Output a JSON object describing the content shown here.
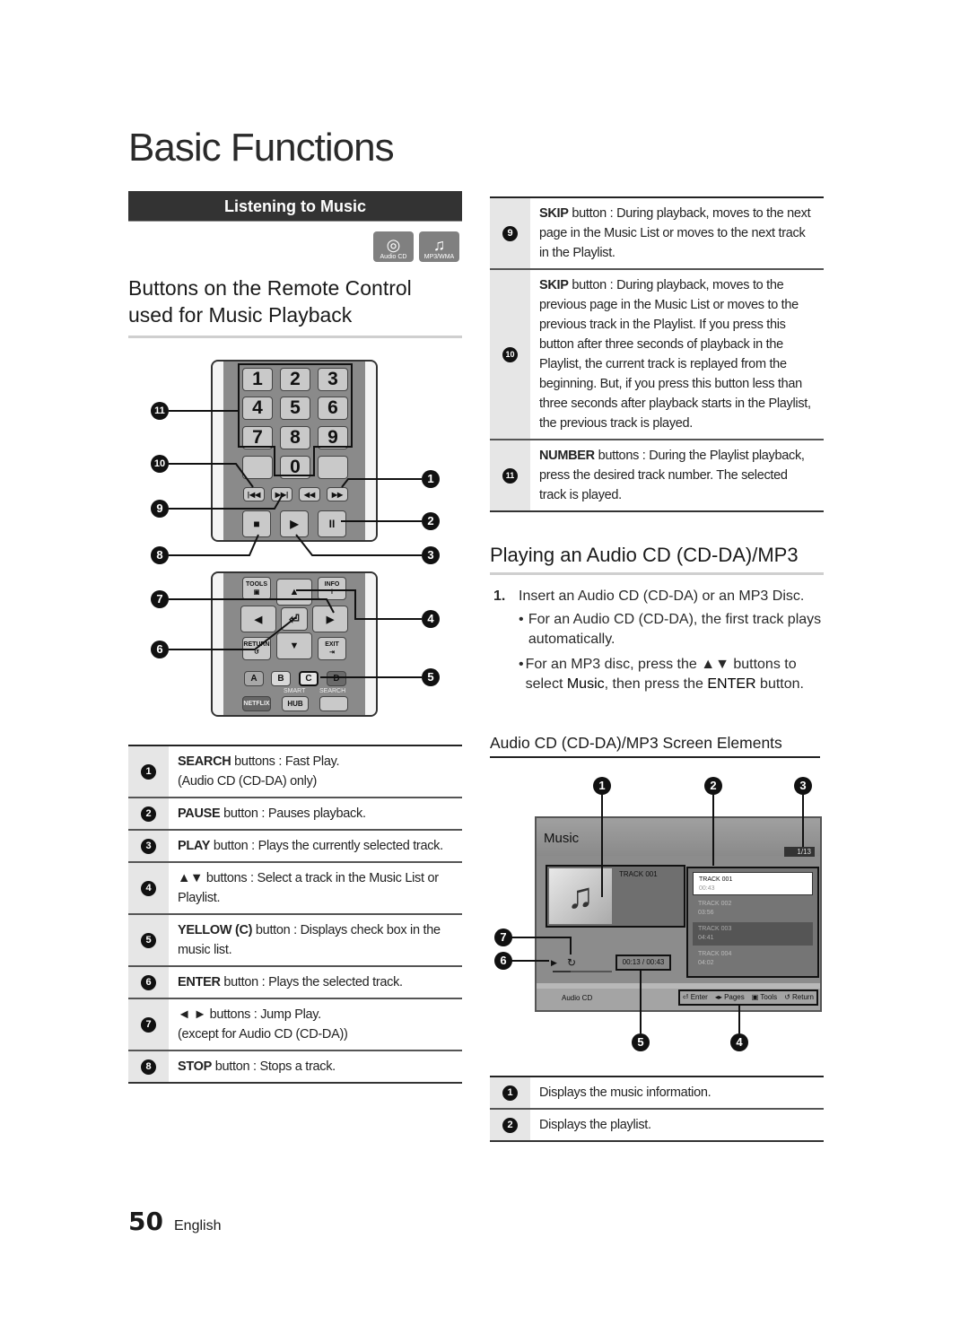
{
  "page": {
    "title": "Basic Functions",
    "section_bar": "Listening to Music",
    "media_icons": [
      {
        "icon": "audio-cd-icon",
        "glyph": "◎",
        "label": "Audio CD"
      },
      {
        "icon": "music-note-icon",
        "glyph": "♫",
        "label": "MP3/WMA"
      }
    ],
    "subheading_line1": "Buttons on the Remote Control",
    "subheading_line2": "used for Music Playback"
  },
  "remote": {
    "number_keys": [
      "1",
      "2",
      "3",
      "4",
      "5",
      "6",
      "7",
      "8",
      "9",
      "0"
    ],
    "transport_keys": [
      "|◀◀",
      "▶▶|",
      "◀◀",
      "▶▶"
    ],
    "play_keys": [
      "■",
      "▶",
      "II"
    ],
    "nav_labels": {
      "tools": "TOOLS",
      "info": "INFO",
      "return": "RETURN",
      "exit": "EXIT",
      "up": "▲",
      "down": "▼",
      "left": "◀",
      "right": "▶",
      "enter": "⏎"
    },
    "color_keys": [
      "A",
      "B",
      "C",
      "D"
    ],
    "bottom_labels": {
      "netflix": "NETFLIX",
      "smart": "SMART",
      "hub": "HUB",
      "search": "SEARCH"
    },
    "callouts": [
      "1",
      "2",
      "3",
      "4",
      "5",
      "6",
      "7",
      "8",
      "9",
      "10",
      "11"
    ]
  },
  "left_table": [
    {
      "num": "1",
      "key": "SEARCH",
      "text": " buttons : Fast Play.",
      "line2": "(Audio CD (CD-DA) only)"
    },
    {
      "num": "2",
      "key": "PAUSE",
      "text": " button : Pauses playback.",
      "line2": ""
    },
    {
      "num": "3",
      "key": "PLAY",
      "text": " button : Plays the currently selected track.",
      "line2": ""
    },
    {
      "num": "4",
      "key": "▲▼",
      "text": " buttons : Select a track in the Music List or",
      "line2": "Playlist."
    },
    {
      "num": "5",
      "key": "YELLOW (C)",
      "text": " button : Displays check box in the",
      "line2": "music list."
    },
    {
      "num": "6",
      "key": "ENTER",
      "text": " button : Plays the selected track.",
      "line2": ""
    },
    {
      "num": "7",
      "key": "◄ ►",
      "text": " buttons : Jump Play.",
      "line2": "(except for Audio CD (CD-DA))"
    },
    {
      "num": "8",
      "key": "STOP",
      "text": " button : Stops a track.",
      "line2": ""
    }
  ],
  "right_table": [
    {
      "num": "9",
      "key": "SKIP",
      "text": " button : During playback, moves to the next page in the Music List or moves to the next track in the Playlist."
    },
    {
      "num": "10",
      "key": "SKIP",
      "text": " button : During playback, moves to the previous page in the Music List or moves to the previous track in the Playlist. If you press this button after three seconds of playback in the Playlist, the current track is replayed from the beginning. But, if you press this button less than three seconds after playback starts in the Playlist, the previous track is played."
    },
    {
      "num": "11",
      "key": "NUMBER",
      "text": " buttons : During the Playlist playback, press the desired track number. The selected track is played."
    }
  ],
  "playing": {
    "heading": "Playing an Audio CD (CD-DA)/MP3",
    "step1_num": "1.",
    "step1_text": "Insert an Audio CD (CD-DA) or an MP3 Disc.",
    "bullet1": "For an Audio CD (CD-DA), the first track plays automatically.",
    "bullet2_a": "For an MP3 disc, press the ▲▼ buttons to select ",
    "bullet2_b": "Music",
    "bullet2_c": ", then press the ",
    "bullet2_d": "ENTER",
    "bullet2_e": " button.",
    "screen_heading": "Audio CD (CD-DA)/MP3 Screen Elements"
  },
  "screen": {
    "title": "Music",
    "page_counter": "1/13",
    "now_playing": "TRACK 001",
    "playlist": [
      {
        "name": "TRACK 001",
        "time": "00:43",
        "state": "selected"
      },
      {
        "name": "TRACK 002",
        "time": "03:56",
        "state": "normal"
      },
      {
        "name": "TRACK 003",
        "time": "04:41",
        "state": "highlighted"
      },
      {
        "name": "TRACK 004",
        "time": "04:02",
        "state": "normal"
      }
    ],
    "elapsed": "00:13 / 00:43",
    "progress_fraction": 0.3,
    "source_label": "Audio CD",
    "keys": [
      "⏎ Enter",
      "◂▸ Pages",
      "▣ Tools",
      "↺ Return"
    ],
    "callouts": [
      "1",
      "2",
      "3",
      "4",
      "5",
      "6",
      "7"
    ]
  },
  "screen_table": [
    {
      "num": "1",
      "text": "Displays the music information."
    },
    {
      "num": "2",
      "text": "Displays the playlist."
    }
  ],
  "footer": {
    "page_number": "50",
    "language": "English"
  }
}
